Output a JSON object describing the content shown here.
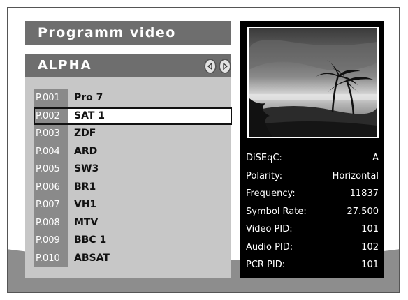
{
  "title": "Programm video",
  "group": {
    "name": "ALPHA",
    "prev_icon": "arrow-left-icon",
    "next_icon": "arrow-right-icon"
  },
  "channels": [
    {
      "num": "P.001",
      "name": "Pro 7"
    },
    {
      "num": "P.002",
      "name": "SAT 1",
      "selected": true
    },
    {
      "num": "P.003",
      "name": "ZDF"
    },
    {
      "num": "P.004",
      "name": "ARD"
    },
    {
      "num": "P.005",
      "name": "SW3"
    },
    {
      "num": "P.006",
      "name": "BR1"
    },
    {
      "num": "P.007",
      "name": "VH1"
    },
    {
      "num": "P.008",
      "name": "MTV"
    },
    {
      "num": "P.009",
      "name": "BBC 1"
    },
    {
      "num": "P.010",
      "name": "ABSAT"
    }
  ],
  "info": [
    {
      "label": "DiSEqC:",
      "value": "A"
    },
    {
      "label": "Polarity:",
      "value": "Horizontal"
    },
    {
      "label": "Frequency:",
      "value": "11837"
    },
    {
      "label": "Symbol Rate:",
      "value": "27.500"
    },
    {
      "label": "Video PID:",
      "value": "101"
    },
    {
      "label": "Audio PID:",
      "value": "102"
    },
    {
      "label": "PCR PID:",
      "value": "101"
    }
  ],
  "preview": {
    "icon": "preview-image"
  },
  "colors": {
    "header_bg": "#6e6e6e",
    "list_bg": "#c7c7c7",
    "number_bg": "#8a8a8a",
    "info_bg": "#000000",
    "background_grey": "#8d8d8d"
  }
}
